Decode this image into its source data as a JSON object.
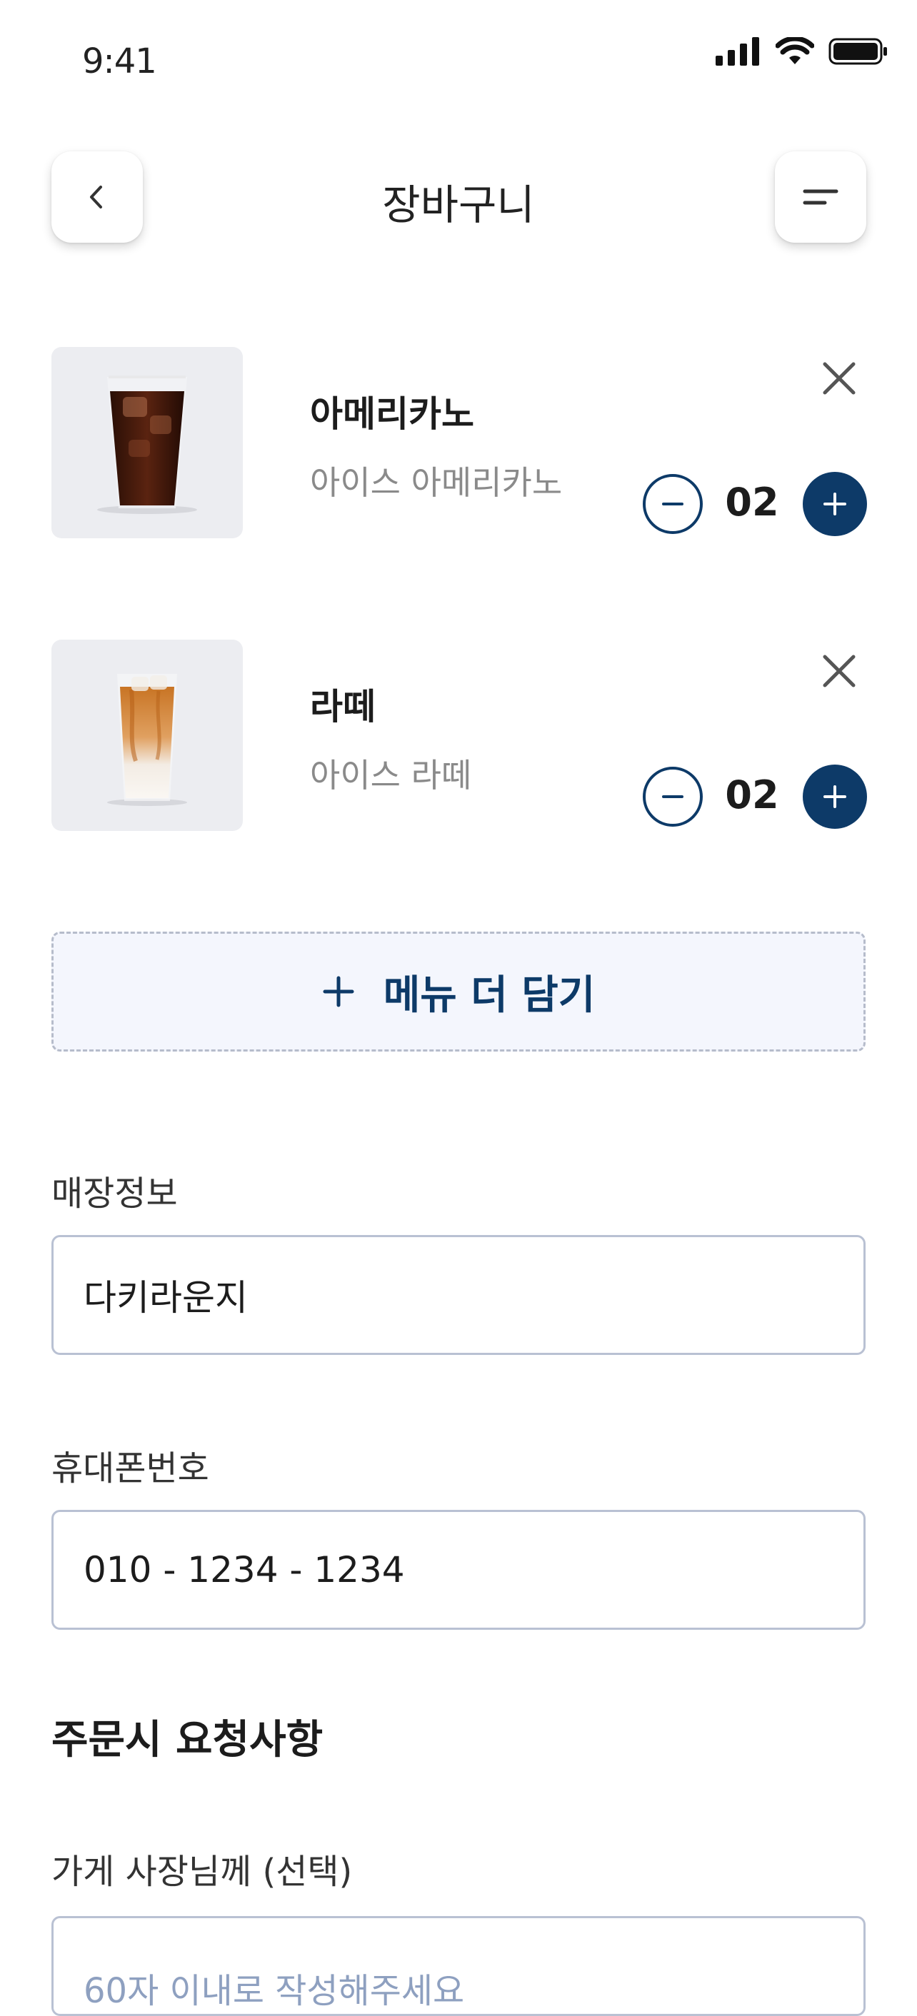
{
  "status_bar": {
    "time": "9:41"
  },
  "header": {
    "title": "장바구니"
  },
  "cart": {
    "items": [
      {
        "name": "아메리카노",
        "subtitle": "아이스 아메리카노",
        "quantity": "02"
      },
      {
        "name": "라떼",
        "subtitle": "아이스 라떼",
        "quantity": "02"
      }
    ]
  },
  "add_more": {
    "label": "메뉴 더 담기"
  },
  "form": {
    "store_label": "매장정보",
    "store_value": "다키라운지",
    "phone_label": "휴대폰번호",
    "phone_value": "010 - 1234  - 1234",
    "request_section_title": "주문시 요청사항",
    "owner_label": "가게 사장님께 (선택)",
    "owner_placeholder": "60자 이내로 작성해주세요"
  },
  "colors": {
    "accent": "#0d3a68",
    "add_more_bg": "#f4f6fd",
    "border": "#b9c1d3"
  }
}
